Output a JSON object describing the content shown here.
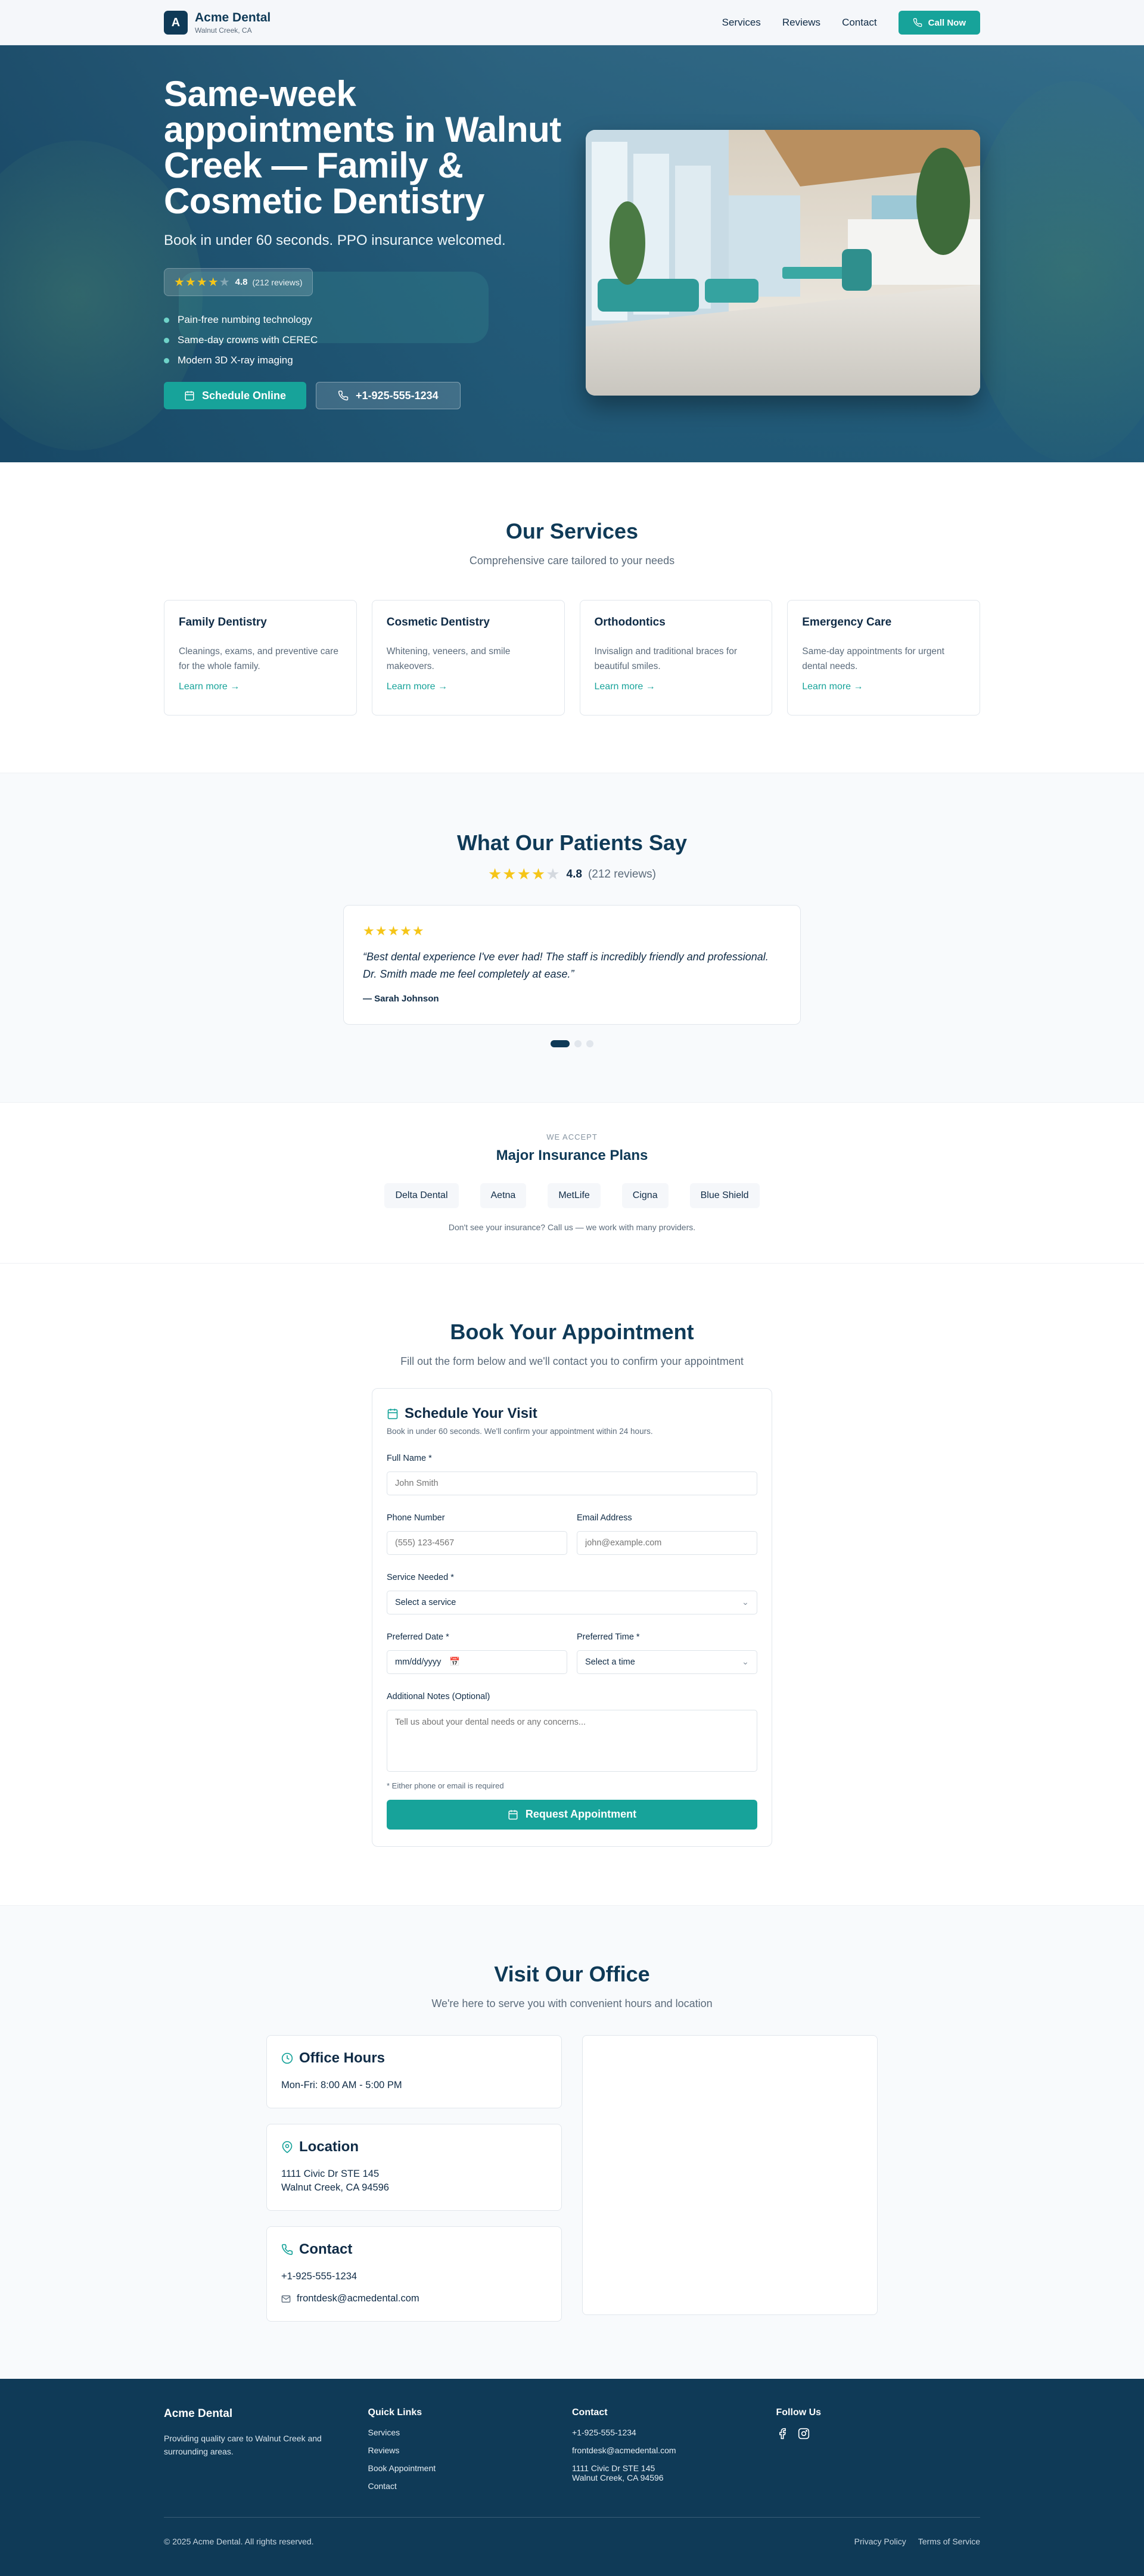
{
  "header": {
    "logo_letter": "A",
    "brand": "Acme Dental",
    "location": "Walnut Creek, CA",
    "nav": [
      "Services",
      "Reviews",
      "Contact"
    ],
    "call_button": "Call Now"
  },
  "hero": {
    "title": "Same-week appointments in Walnut Creek — Family & Cosmetic Dentistry",
    "subtitle": "Book in under 60 seconds. PPO insurance welcomed.",
    "rating": "4.8",
    "rating_count": "(212 reviews)",
    "rating_stars": 4,
    "bullets": [
      "Pain-free numbing technology",
      "Same-day crowns with CEREC",
      "Modern 3D X-ray imaging"
    ],
    "cta_primary": "Schedule Online",
    "cta_phone": "+1-925-555-1234"
  },
  "services": {
    "title": "Our Services",
    "subtitle": "Comprehensive care tailored to your needs",
    "items": [
      {
        "title": "Family Dentistry",
        "desc": "Cleanings, exams, and preventive care for the whole family.",
        "link": "Learn more →"
      },
      {
        "title": "Cosmetic Dentistry",
        "desc": "Whitening, veneers, and smile makeovers.",
        "link": "Learn more →"
      },
      {
        "title": "Orthodontics",
        "desc": "Invisalign and traditional braces for beautiful smiles.",
        "link": "Learn more →"
      },
      {
        "title": "Emergency Care",
        "desc": "Same-day appointments for urgent dental needs.",
        "link": "Learn more →"
      }
    ]
  },
  "reviews": {
    "title": "What Our Patients Say",
    "rating": "4.8",
    "count": "(212 reviews)",
    "testimonial": {
      "stars": 5,
      "text": "“Best dental experience I've ever had! The staff is incredibly friendly and professional. Dr. Smith made me feel completely at ease.”",
      "author": "— Sarah Johnson"
    },
    "carousel_active": 1,
    "carousel_total": 3
  },
  "insurance": {
    "eyebrow": "WE ACCEPT",
    "title": "Major Insurance Plans",
    "plans": [
      "Delta Dental",
      "Aetna",
      "MetLife",
      "Cigna",
      "Blue Shield"
    ],
    "note": "Don't see your insurance? Call us — we work with many providers."
  },
  "booking": {
    "title": "Book Your Appointment",
    "subtitle": "Fill out the form below and we'll contact you to confirm your appointment",
    "card_title": "Schedule Your Visit",
    "card_note": "Book in under 60 seconds. We'll confirm your appointment within 24 hours.",
    "full_name_label": "Full Name *",
    "full_name_placeholder": "John Smith",
    "phone_label": "Phone Number",
    "phone_placeholder": "(555) 123-4567",
    "email_label": "Email Address",
    "email_placeholder": "john@example.com",
    "service_label": "Service Needed *",
    "service_value": "Select a service",
    "date_label": "Preferred Date *",
    "date_value": "mm/dd/yyyy",
    "time_label": "Preferred Time *",
    "time_value": "Select a time",
    "notes_label": "Additional Notes (Optional)",
    "notes_placeholder": "Tell us about your dental needs or any concerns...",
    "required_note": "* Either phone or email is required",
    "submit": "Request Appointment"
  },
  "office": {
    "title": "Visit Our Office",
    "subtitle": "We're here to serve you with convenient hours and location",
    "hours_title": "Office Hours",
    "hours": "Mon-Fri: 8:00 AM - 5:00 PM",
    "location_title": "Location",
    "address_line1": "1111 Civic Dr STE 145",
    "address_line2": "Walnut Creek, CA 94596",
    "contact_title": "Contact",
    "phone": "+1-925-555-1234",
    "email": "frontdesk@acmedental.com"
  },
  "footer": {
    "brand": "Acme Dental",
    "tagline": "Providing quality care to Walnut Creek and surrounding areas.",
    "quick_links_title": "Quick Links",
    "quick_links": [
      "Services",
      "Reviews",
      "Book Appointment",
      "Contact"
    ],
    "contact_title": "Contact",
    "phone": "+1-925-555-1234",
    "email": "frontdesk@acmedental.com",
    "address_line1": "1111 Civic Dr STE 145",
    "address_line2": "Walnut Creek, CA 94596",
    "follow_title": "Follow Us",
    "copyright": "© 2025 Acme Dental. All rights reserved.",
    "privacy": "Privacy Policy",
    "terms": "Terms of Service"
  },
  "colors": {
    "primary": "#0f3a57",
    "accent": "#17a39a",
    "star": "#f5c518"
  }
}
